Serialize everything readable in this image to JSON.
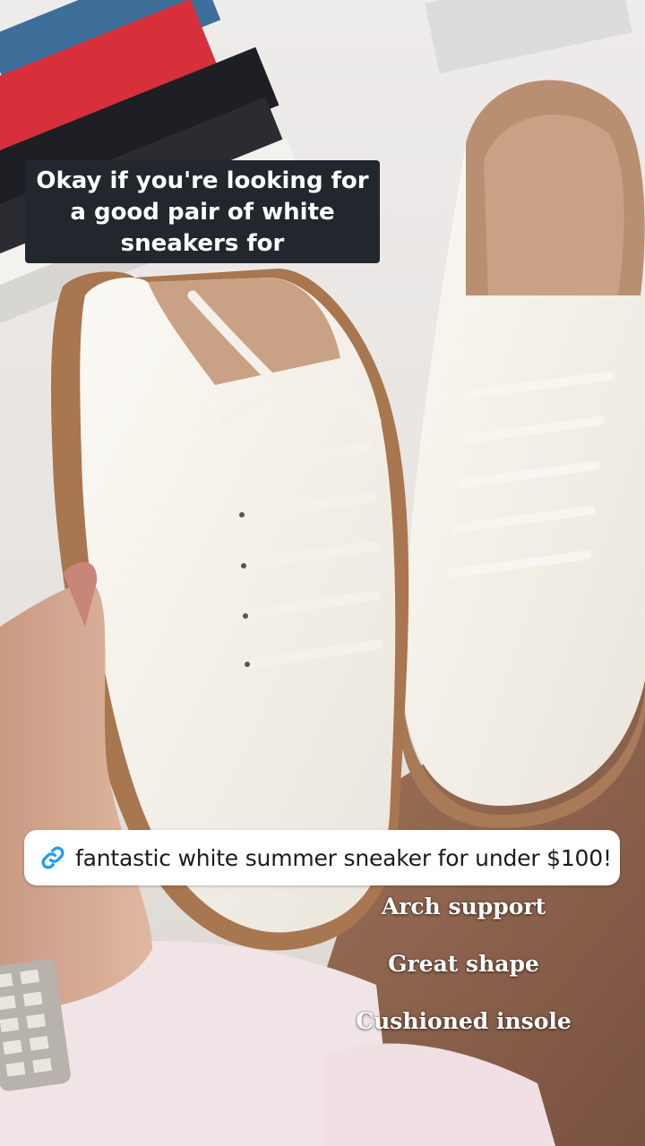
{
  "caption": {
    "line1": "Okay if you're looking for",
    "line2": "a good pair of white",
    "line3": "sneakers for"
  },
  "link_sticker": {
    "icon": "link-icon",
    "text": "fantastic white summer sneaker for under $100!"
  },
  "features": [
    "Arch support",
    "Great shape",
    "Cushioned insole"
  ],
  "colors": {
    "caption_bg": "#22272d",
    "link_icon": "#1e9bf0",
    "sticker_bg": "#ffffff"
  }
}
